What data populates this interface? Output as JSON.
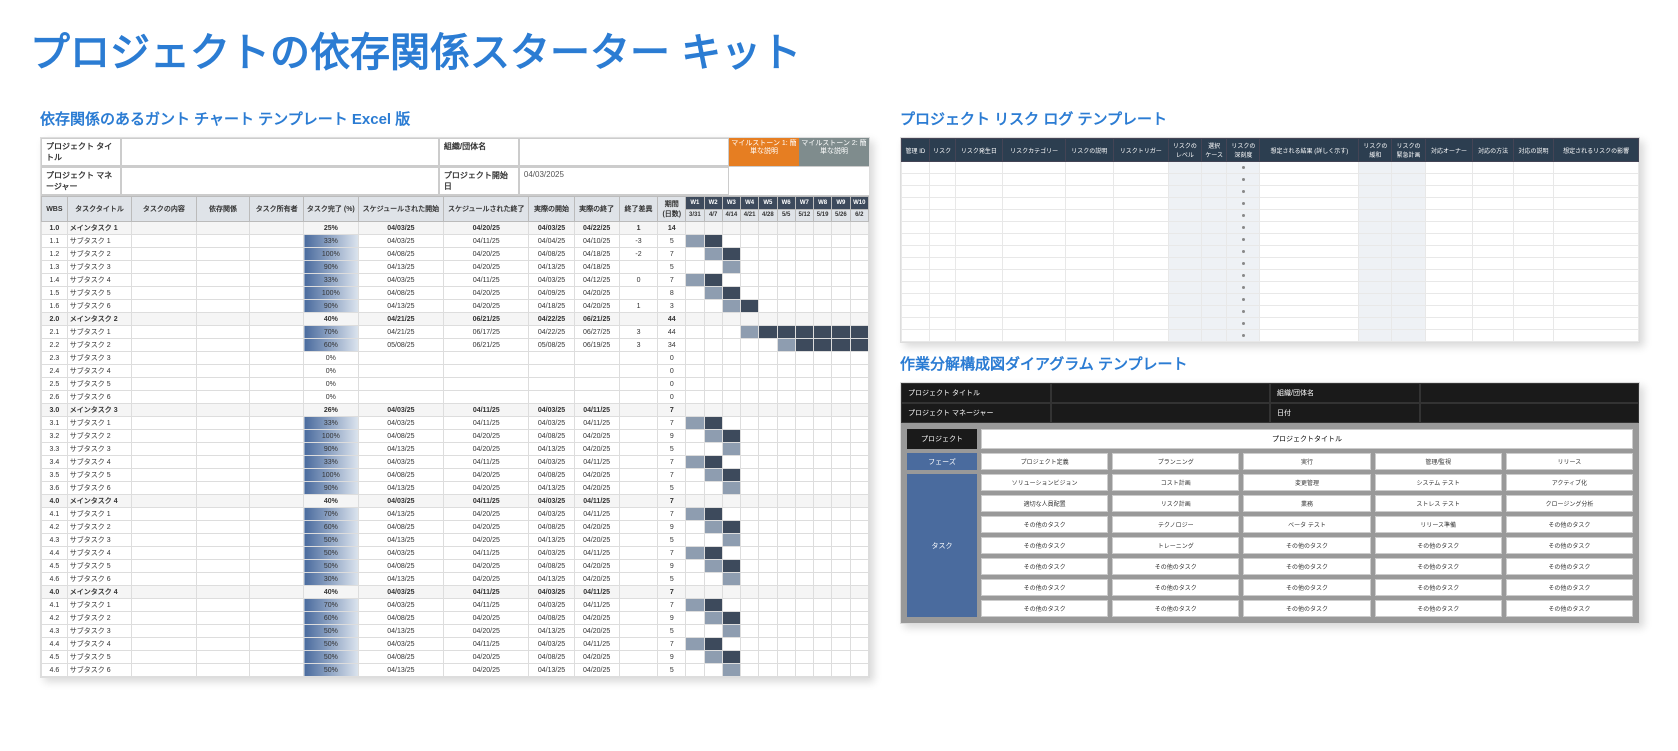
{
  "page_title": "プロジェクトの依存関係スターター キット",
  "gantt": {
    "title": "依存関係のあるガント チャート テンプレート Excel 版",
    "meta": {
      "project_title_label": "プロジェクト タイトル",
      "project_title": "",
      "company_label": "組織/団体名",
      "company": "",
      "pm_label": "プロジェクト マネージャー",
      "pm": "",
      "start_label": "プロジェクト開始日",
      "start": "04/03/2025"
    },
    "milestones": {
      "m1": "マイルストーン 1:\n簡単な説明",
      "m2": "マイルストーン 2:\n簡単な説明"
    },
    "headers": [
      "WBS",
      "タスクタイトル",
      "タスクの内容",
      "依存関係",
      "タスク所有者",
      "タスク完了 (%)",
      "スケジュールされた開始",
      "スケジュールされた終了",
      "実際の開始",
      "実際の終了",
      "終了差異",
      "期間\n(日数)"
    ],
    "week_labels": [
      "W1",
      "W2",
      "W3",
      "W4",
      "W5",
      "W6",
      "W7",
      "W8",
      "W9",
      "W10"
    ],
    "week_dates": [
      "3/31",
      "4/7",
      "4/14",
      "4/21",
      "4/28",
      "5/5",
      "5/12",
      "5/19",
      "5/26",
      "6/2"
    ],
    "rows": [
      {
        "wbs": "1.0",
        "t": "メインタスク 1",
        "pct": "25%",
        "d": [
          "04/03/25",
          "04/20/25",
          "04/03/25",
          "04/22/25"
        ],
        "se": "1",
        "dur": "14",
        "main": true,
        "bar": [
          0,
          3
        ]
      },
      {
        "wbs": "1.1",
        "t": "サブタスク 1",
        "pct": "33%",
        "d": [
          "04/03/25",
          "04/11/25",
          "04/04/25",
          "04/10/25"
        ],
        "se": "-3",
        "dur": "5",
        "bar": [
          0,
          1
        ]
      },
      {
        "wbs": "1.2",
        "t": "サブタスク 2",
        "pct": "100%",
        "d": [
          "04/08/25",
          "04/20/25",
          "04/08/25",
          "04/18/25"
        ],
        "se": "-2",
        "dur": "7",
        "bar": [
          1,
          2
        ]
      },
      {
        "wbs": "1.3",
        "t": "サブタスク 3",
        "pct": "90%",
        "d": [
          "04/13/25",
          "04/20/25",
          "04/13/25",
          "04/18/25"
        ],
        "se": "",
        "dur": "5",
        "bar": [
          2,
          2
        ]
      },
      {
        "wbs": "1.4",
        "t": "サブタスク 4",
        "pct": "33%",
        "d": [
          "04/03/25",
          "04/11/25",
          "04/03/25",
          "04/12/25"
        ],
        "se": "0",
        "dur": "7",
        "bar": [
          0,
          1
        ]
      },
      {
        "wbs": "1.5",
        "t": "サブタスク 5",
        "pct": "100%",
        "d": [
          "04/08/25",
          "04/20/25",
          "04/09/25",
          "04/20/25"
        ],
        "se": "",
        "dur": "8",
        "bar": [
          1,
          2
        ]
      },
      {
        "wbs": "1.6",
        "t": "サブタスク 6",
        "pct": "90%",
        "d": [
          "04/13/25",
          "04/20/25",
          "04/18/25",
          "04/20/25"
        ],
        "se": "1",
        "dur": "3",
        "bar": [
          2,
          3
        ]
      },
      {
        "wbs": "2.0",
        "t": "メインタスク 2",
        "pct": "40%",
        "d": [
          "04/21/25",
          "06/21/25",
          "04/22/25",
          "06/21/25"
        ],
        "se": "",
        "dur": "44",
        "main": true,
        "bar": [
          3,
          9
        ]
      },
      {
        "wbs": "2.1",
        "t": "サブタスク 1",
        "pct": "70%",
        "d": [
          "04/21/25",
          "06/17/25",
          "04/22/25",
          "06/27/25"
        ],
        "se": "3",
        "dur": "44",
        "bar": [
          3,
          9
        ]
      },
      {
        "wbs": "2.2",
        "t": "サブタスク 2",
        "pct": "60%",
        "d": [
          "05/08/25",
          "06/21/25",
          "05/08/25",
          "06/19/25"
        ],
        "se": "3",
        "dur": "34",
        "bar": [
          5,
          9
        ]
      },
      {
        "wbs": "2.3",
        "t": "サブタスク 3",
        "pct": "0%",
        "d": [
          "",
          "",
          "",
          ""
        ],
        "se": "",
        "dur": "0"
      },
      {
        "wbs": "2.4",
        "t": "サブタスク 4",
        "pct": "0%",
        "d": [
          "",
          "",
          "",
          ""
        ],
        "se": "",
        "dur": "0"
      },
      {
        "wbs": "2.5",
        "t": "サブタスク 5",
        "pct": "0%",
        "d": [
          "",
          "",
          "",
          ""
        ],
        "se": "",
        "dur": "0"
      },
      {
        "wbs": "2.6",
        "t": "サブタスク 6",
        "pct": "0%",
        "d": [
          "",
          "",
          "",
          ""
        ],
        "se": "",
        "dur": "0"
      },
      {
        "wbs": "3.0",
        "t": "メインタスク 3",
        "pct": "26%",
        "d": [
          "04/03/25",
          "04/11/25",
          "04/03/25",
          "04/11/25"
        ],
        "se": "",
        "dur": "7",
        "main": true,
        "bar": [
          0,
          1
        ]
      },
      {
        "wbs": "3.1",
        "t": "サブタスク 1",
        "pct": "33%",
        "d": [
          "04/03/25",
          "04/11/25",
          "04/03/25",
          "04/11/25"
        ],
        "se": "",
        "dur": "7",
        "bar": [
          0,
          1
        ]
      },
      {
        "wbs": "3.2",
        "t": "サブタスク 2",
        "pct": "100%",
        "d": [
          "04/08/25",
          "04/20/25",
          "04/08/25",
          "04/20/25"
        ],
        "se": "",
        "dur": "9",
        "bar": [
          1,
          2
        ]
      },
      {
        "wbs": "3.3",
        "t": "サブタスク 3",
        "pct": "90%",
        "d": [
          "04/13/25",
          "04/20/25",
          "04/13/25",
          "04/20/25"
        ],
        "se": "",
        "dur": "5",
        "bar": [
          2,
          2
        ]
      },
      {
        "wbs": "3.4",
        "t": "サブタスク 4",
        "pct": "33%",
        "d": [
          "04/03/25",
          "04/11/25",
          "04/03/25",
          "04/11/25"
        ],
        "se": "",
        "dur": "7",
        "bar": [
          0,
          1
        ]
      },
      {
        "wbs": "3.5",
        "t": "サブタスク 5",
        "pct": "100%",
        "d": [
          "04/08/25",
          "04/20/25",
          "04/08/25",
          "04/20/25"
        ],
        "se": "",
        "dur": "7",
        "bar": [
          1,
          2
        ]
      },
      {
        "wbs": "3.6",
        "t": "サブタスク 6",
        "pct": "90%",
        "d": [
          "04/13/25",
          "04/20/25",
          "04/13/25",
          "04/20/25"
        ],
        "se": "",
        "dur": "5",
        "bar": [
          2,
          2
        ]
      },
      {
        "wbs": "4.0",
        "t": "メインタスク 4",
        "pct": "40%",
        "d": [
          "04/03/25",
          "04/11/25",
          "04/03/25",
          "04/11/25"
        ],
        "se": "",
        "dur": "7",
        "main": true,
        "bar": [
          0,
          1
        ]
      },
      {
        "wbs": "4.1",
        "t": "サブタスク 1",
        "pct": "70%",
        "d": [
          "04/13/25",
          "04/20/25",
          "04/03/25",
          "04/11/25"
        ],
        "se": "",
        "dur": "7",
        "bar": [
          0,
          1
        ]
      },
      {
        "wbs": "4.2",
        "t": "サブタスク 2",
        "pct": "60%",
        "d": [
          "04/08/25",
          "04/20/25",
          "04/08/25",
          "04/20/25"
        ],
        "se": "",
        "dur": "9",
        "bar": [
          1,
          2
        ]
      },
      {
        "wbs": "4.3",
        "t": "サブタスク 3",
        "pct": "50%",
        "d": [
          "04/13/25",
          "04/20/25",
          "04/13/25",
          "04/20/25"
        ],
        "se": "",
        "dur": "5",
        "bar": [
          2,
          2
        ]
      },
      {
        "wbs": "4.4",
        "t": "サブタスク 4",
        "pct": "50%",
        "d": [
          "04/03/25",
          "04/11/25",
          "04/03/25",
          "04/11/25"
        ],
        "se": "",
        "dur": "7",
        "bar": [
          0,
          1
        ]
      },
      {
        "wbs": "4.5",
        "t": "サブタスク 5",
        "pct": "50%",
        "d": [
          "04/08/25",
          "04/20/25",
          "04/08/25",
          "04/20/25"
        ],
        "se": "",
        "dur": "9",
        "bar": [
          1,
          2
        ]
      },
      {
        "wbs": "4.6",
        "t": "サブタスク 6",
        "pct": "30%",
        "d": [
          "04/13/25",
          "04/20/25",
          "04/13/25",
          "04/20/25"
        ],
        "se": "",
        "dur": "5",
        "bar": [
          2,
          2
        ]
      },
      {
        "wbs": "4.0",
        "t": "メインタスク 4",
        "pct": "40%",
        "d": [
          "04/03/25",
          "04/11/25",
          "04/03/25",
          "04/11/25"
        ],
        "se": "",
        "dur": "7",
        "main": true,
        "bar": [
          0,
          1
        ]
      },
      {
        "wbs": "4.1",
        "t": "サブタスク 1",
        "pct": "70%",
        "d": [
          "04/03/25",
          "04/11/25",
          "04/03/25",
          "04/11/25"
        ],
        "se": "",
        "dur": "7",
        "bar": [
          0,
          1
        ]
      },
      {
        "wbs": "4.2",
        "t": "サブタスク 2",
        "pct": "60%",
        "d": [
          "04/08/25",
          "04/20/25",
          "04/08/25",
          "04/20/25"
        ],
        "se": "",
        "dur": "9",
        "bar": [
          1,
          2
        ]
      },
      {
        "wbs": "4.3",
        "t": "サブタスク 3",
        "pct": "50%",
        "d": [
          "04/13/25",
          "04/20/25",
          "04/13/25",
          "04/20/25"
        ],
        "se": "",
        "dur": "5",
        "bar": [
          2,
          2
        ]
      },
      {
        "wbs": "4.4",
        "t": "サブタスク 4",
        "pct": "50%",
        "d": [
          "04/03/25",
          "04/11/25",
          "04/03/25",
          "04/11/25"
        ],
        "se": "",
        "dur": "7",
        "bar": [
          0,
          1
        ]
      },
      {
        "wbs": "4.5",
        "t": "サブタスク 5",
        "pct": "50%",
        "d": [
          "04/08/25",
          "04/20/25",
          "04/08/25",
          "04/20/25"
        ],
        "se": "",
        "dur": "9",
        "bar": [
          1,
          2
        ]
      },
      {
        "wbs": "4.6",
        "t": "サブタスク 6",
        "pct": "50%",
        "d": [
          "04/13/25",
          "04/20/25",
          "04/13/25",
          "04/20/25"
        ],
        "se": "",
        "dur": "5",
        "bar": [
          2,
          2
        ]
      }
    ]
  },
  "risk": {
    "title": "プロジェクト リスク ログ テンプレート",
    "headers": [
      "管理 ID",
      "リスク",
      "リスク発生日",
      "リスクカテゴリー",
      "リスクの説明",
      "リスクトリガー",
      "リスクの\nレベル",
      "選択\nケース",
      "リスクの\n深刻度",
      "想定される結果 (詳しく示す)",
      "リスクの\n緩和",
      "リスクの\n緊急計画",
      "対応オーナー",
      "対応の方法",
      "対応の説明",
      "想定されるリスクの影響"
    ]
  },
  "wbs": {
    "title": "作業分解構成図ダイアグラム テンプレート",
    "meta_labels": {
      "project": "プロジェクト タイトル",
      "company": "組織/団体名",
      "pm": "プロジェクト マネージャー",
      "date": "日付"
    },
    "row_headers": [
      "プロジェクト",
      "フェーズ",
      "タスク"
    ],
    "project_cell": "プロジェクトタイトル",
    "phases": [
      "プロジェクト定義",
      "プランニング",
      "実行",
      "管理/監視",
      "リリース"
    ],
    "tasks": [
      [
        "ソリューションビジョン",
        "コスト計画",
        "変更管理",
        "システム テスト",
        "アクティブ化"
      ],
      [
        "適切な人員配置",
        "リスク計画",
        "業務",
        "ストレス テスト",
        "クロージング分析"
      ],
      [
        "その他のタスク",
        "テクノロジー",
        "ベータ テスト",
        "リリース準備",
        "その他のタスク"
      ],
      [
        "その他のタスク",
        "トレーニング",
        "その他のタスク",
        "その他のタスク",
        "その他のタスク"
      ],
      [
        "その他のタスク",
        "その他のタスク",
        "その他のタスク",
        "その他のタスク",
        "その他のタスク"
      ],
      [
        "その他のタスク",
        "その他のタスク",
        "その他のタスク",
        "その他のタスク",
        "その他のタスク"
      ],
      [
        "その他のタスク",
        "その他のタスク",
        "その他のタスク",
        "その他のタスク",
        "その他のタスク"
      ]
    ]
  }
}
